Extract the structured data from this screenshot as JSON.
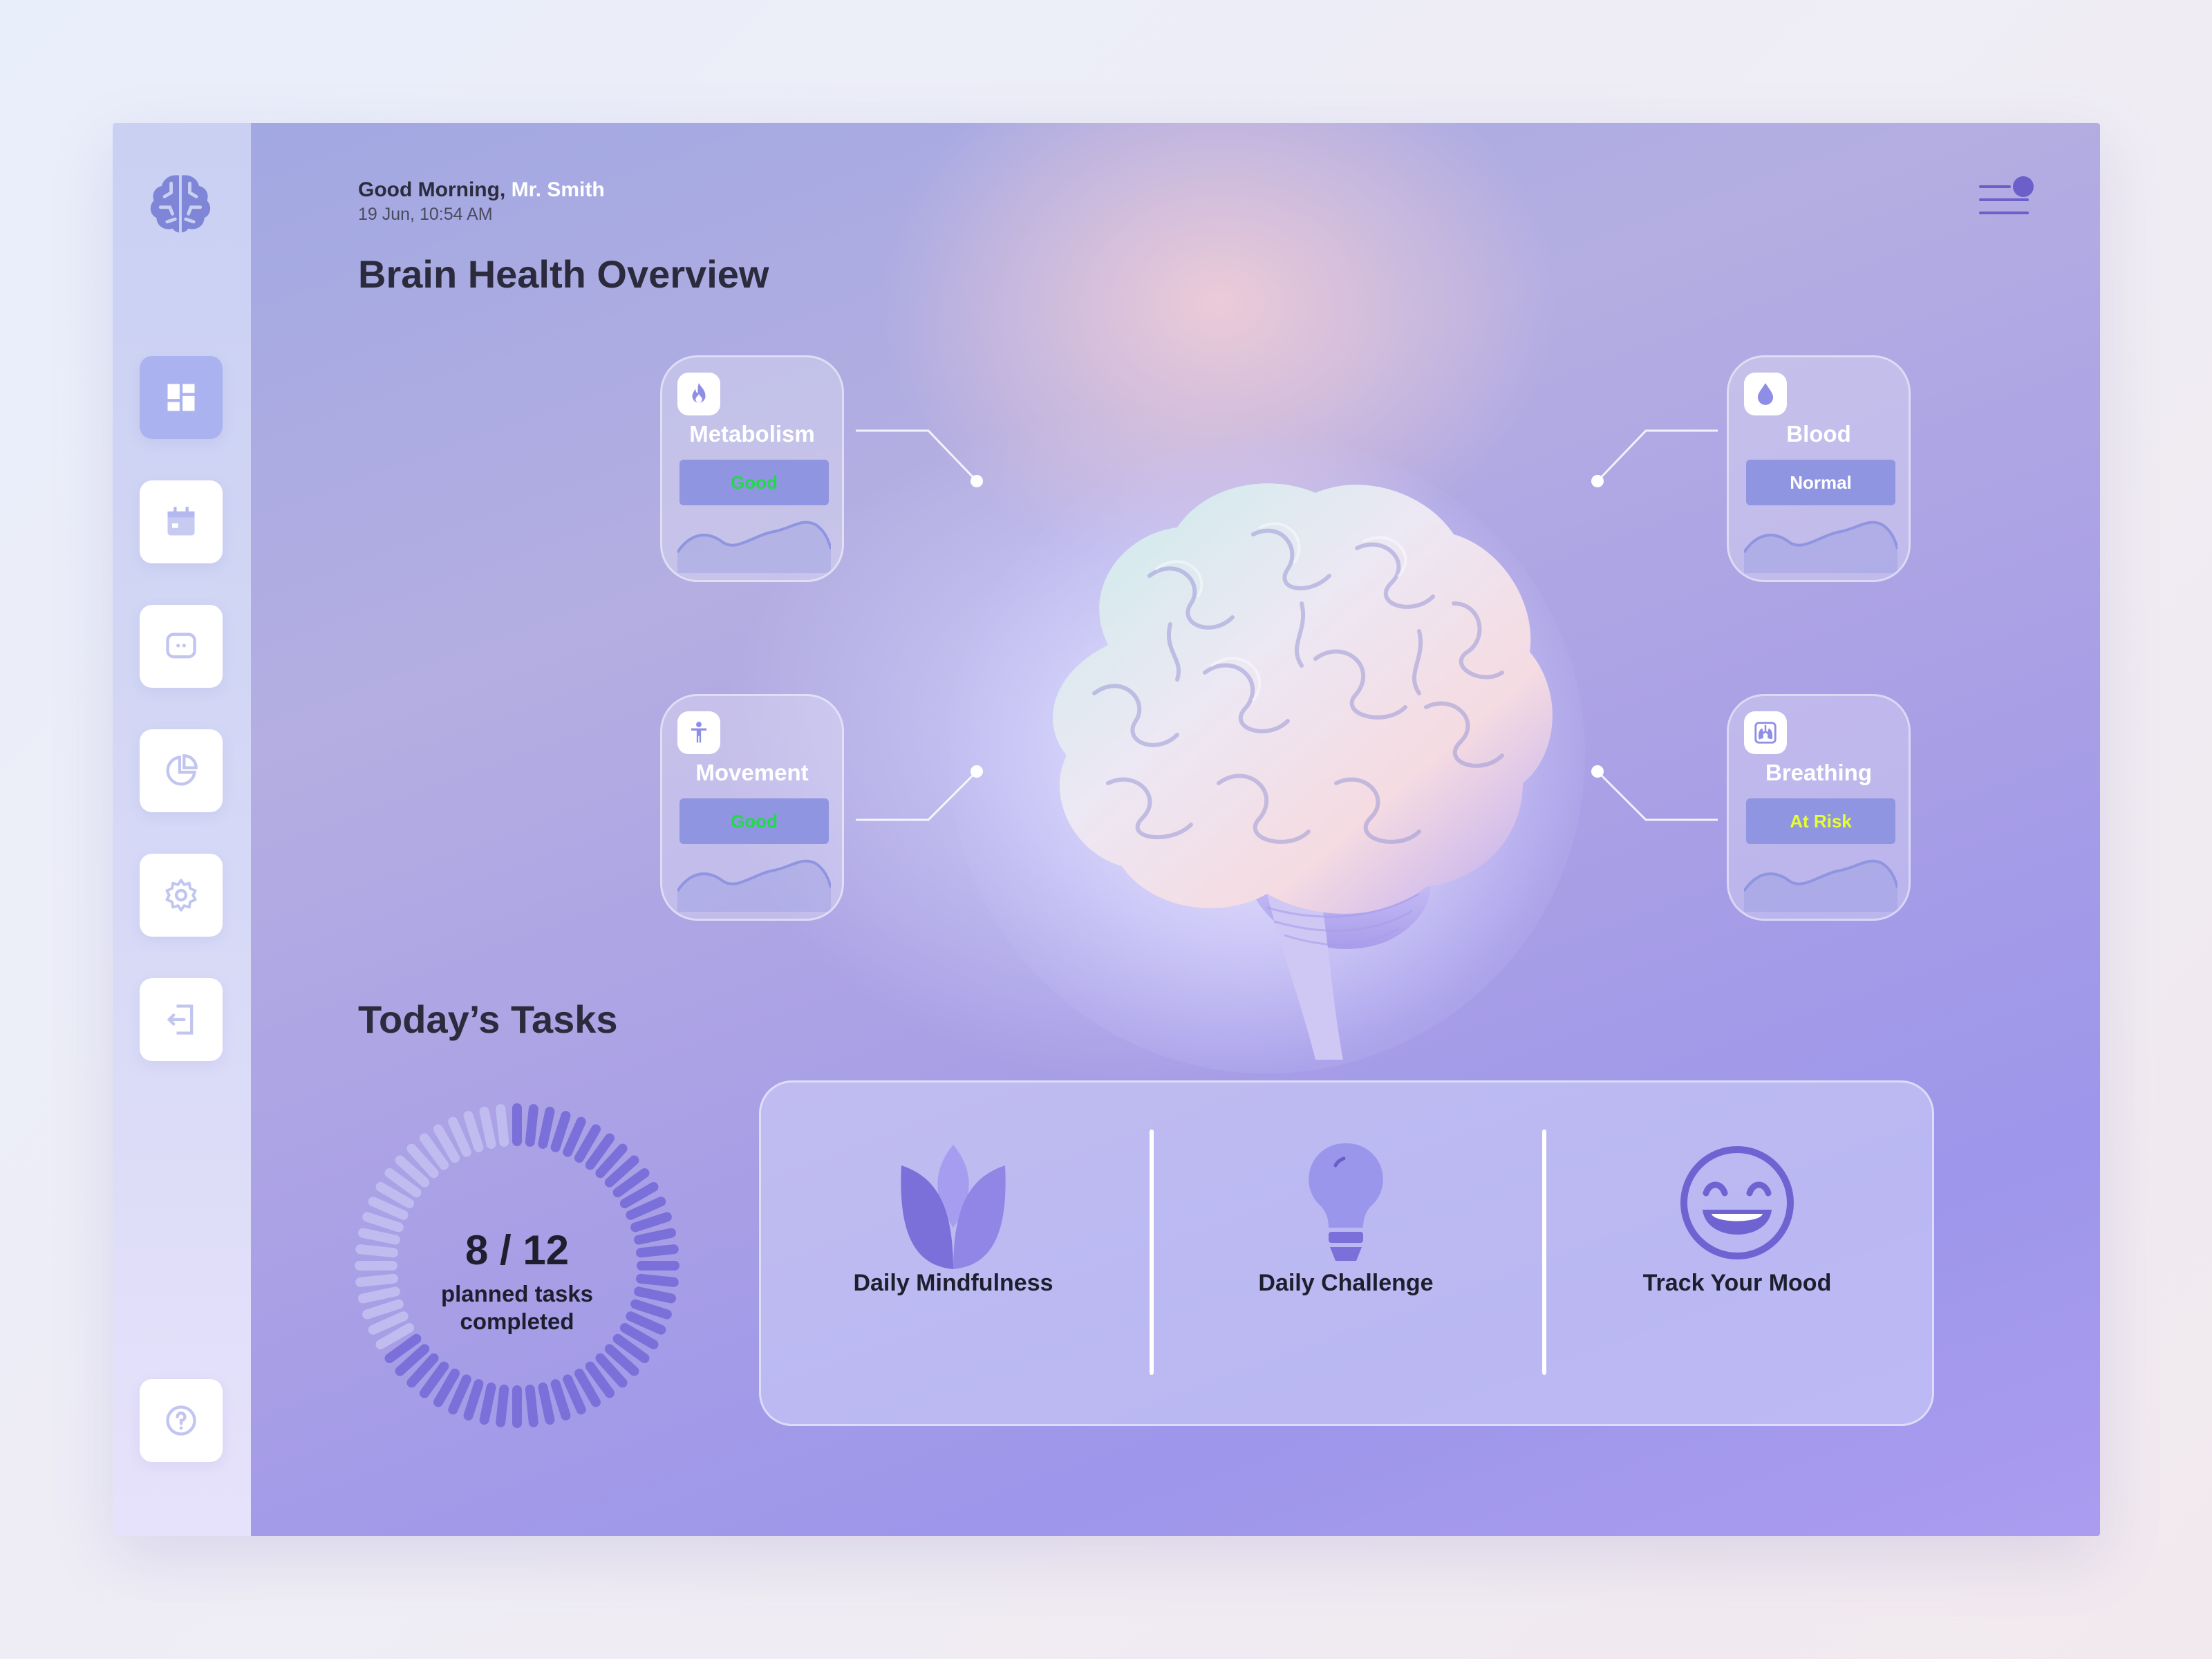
{
  "header": {
    "greeting_prefix": "Good Morning,",
    "user_name": "Mr. Smith",
    "datetime": "19 Jun, 10:54 AM"
  },
  "sidebar": {
    "logo_icon": "brain-logo-icon",
    "items": [
      {
        "icon": "dashboard-icon",
        "active": true
      },
      {
        "icon": "calendar-icon",
        "active": false
      },
      {
        "icon": "chat-icon",
        "active": false
      },
      {
        "icon": "pie-chart-icon",
        "active": false
      },
      {
        "icon": "settings-icon",
        "active": false
      },
      {
        "icon": "logout-icon",
        "active": false
      }
    ],
    "help_icon": "help-icon"
  },
  "overview": {
    "title": "Brain Health Overview",
    "metrics": [
      {
        "label": "Metabolism",
        "status": "Good",
        "status_color": "#22d94a",
        "icon": "flame-icon"
      },
      {
        "label": "Blood",
        "status": "Normal",
        "status_color": "#ffffff",
        "icon": "drop-icon"
      },
      {
        "label": "Movement",
        "status": "Good",
        "status_color": "#22d94a",
        "icon": "person-icon"
      },
      {
        "label": "Breathing",
        "status": "At Risk",
        "status_color": "#e6ff2e",
        "icon": "lungs-icon"
      }
    ]
  },
  "tasks": {
    "title": "Today’s Tasks",
    "completed": 8,
    "planned": 12,
    "progress_value": "8 / 12",
    "progress_caption": "planned tasks completed",
    "items": [
      {
        "label": "Daily Mindfulness",
        "icon": "lotus-icon"
      },
      {
        "label": "Daily Challenge",
        "icon": "lightbulb-icon"
      },
      {
        "label": "Track Your Mood",
        "icon": "smiley-icon"
      }
    ]
  },
  "colors": {
    "accent": "#7b6fd9",
    "accent_light": "#aab2ef",
    "ring_track": "#c0bcf0"
  }
}
